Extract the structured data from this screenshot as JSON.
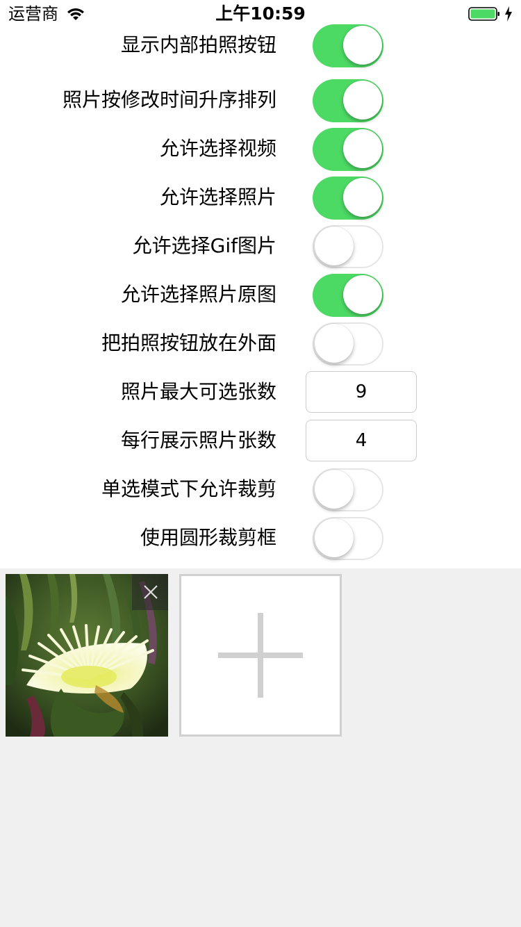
{
  "status_bar": {
    "carrier": "运营商",
    "time": "上午10:59",
    "battery_color": "#4cd964",
    "icons": [
      "wifi-icon",
      "battery-icon",
      "charging-icon"
    ]
  },
  "settings": [
    {
      "label": "显示内部拍照按钮",
      "type": "switch",
      "on": true
    },
    {
      "label": "照片按修改时间升序排列",
      "type": "switch",
      "on": true
    },
    {
      "label": "允许选择视频",
      "type": "switch",
      "on": true
    },
    {
      "label": "允许选择照片",
      "type": "switch",
      "on": true
    },
    {
      "label": "允许选择Gif图片",
      "type": "switch",
      "on": false
    },
    {
      "label": "允许选择照片原图",
      "type": "switch",
      "on": true
    },
    {
      "label": "把拍照按钮放在外面",
      "type": "switch",
      "on": false
    },
    {
      "label": "照片最大可选张数",
      "type": "field",
      "value": "9"
    },
    {
      "label": "每行展示照片张数",
      "type": "field",
      "value": "4"
    },
    {
      "label": "单选模式下允许裁剪",
      "type": "switch",
      "on": false
    },
    {
      "label": "使用圆形裁剪框",
      "type": "switch",
      "on": false
    }
  ],
  "colors": {
    "switch_on": "#4cd964",
    "background": "#f0f0f0",
    "add_border": "#d0d0d0"
  },
  "photos": {
    "selected_photo_icon": "flower-photo",
    "delete_icon": "close-icon",
    "add_icon": "plus-icon"
  }
}
